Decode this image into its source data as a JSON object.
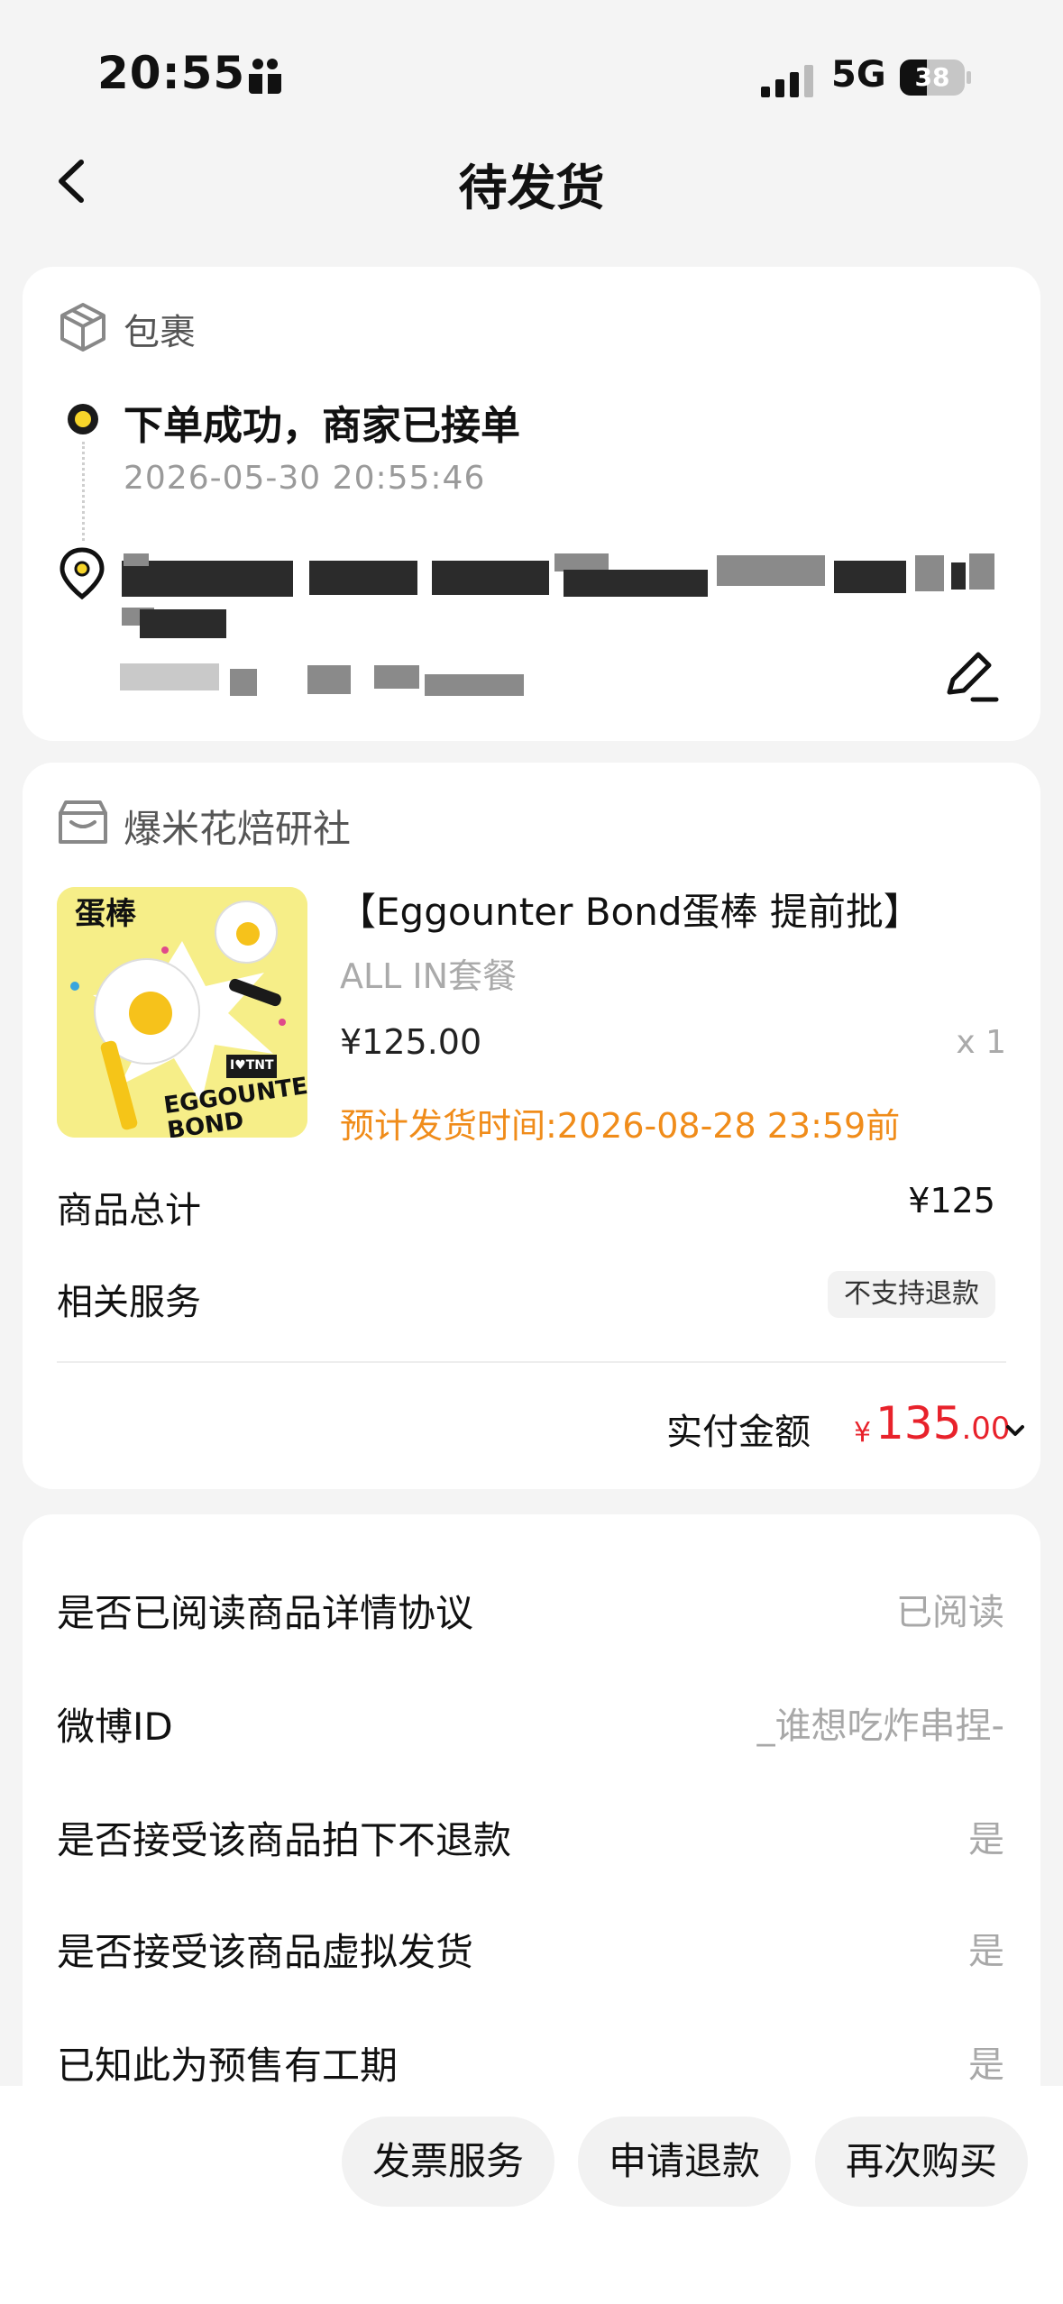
{
  "status_bar": {
    "time": "20:55",
    "network": "5G",
    "battery": "38"
  },
  "nav": {
    "title": "待发货"
  },
  "parcel": {
    "label": "包裹",
    "status": "下单成功，商家已接单",
    "time": "2026-05-30 20:55:46"
  },
  "order": {
    "shop_name": "爆米花焙研社",
    "product_name": "【Eggounter Bond蛋棒 提前批】",
    "spec": "ALL IN套餐",
    "price": "¥125.00",
    "qty": "x 1",
    "ship_time": "预计发货时间:2026-08-28 23:59前",
    "thumb_text": {
      "top": "蛋棒",
      "bottom": "EGGOUNTER BOND",
      "tag": "I♥TNT"
    },
    "subtotal_label": "商品总计",
    "subtotal_value": "¥125",
    "service_label": "相关服务",
    "service_badge": "不支持退款",
    "paid_label": "实付金额",
    "paid_currency": "¥",
    "paid_int": "135",
    "paid_dec": ".00"
  },
  "info": [
    {
      "label": "是否已阅读商品详情协议",
      "value": "已阅读"
    },
    {
      "label": "微博ID",
      "value": "_谁想吃炸串捏-"
    },
    {
      "label": "是否接受该商品拍下不退款",
      "value": "是"
    },
    {
      "label": "是否接受该商品虚拟发货",
      "value": "是"
    },
    {
      "label": "已知此为预售有工期",
      "value": "是"
    }
  ],
  "actions": {
    "invoice": "发票服务",
    "refund": "申请退款",
    "rebuy": "再次购买"
  },
  "colors": {
    "accent_yellow": "#f7d52a",
    "price_red": "#e8222b",
    "ship_orange": "#f08c1a"
  }
}
